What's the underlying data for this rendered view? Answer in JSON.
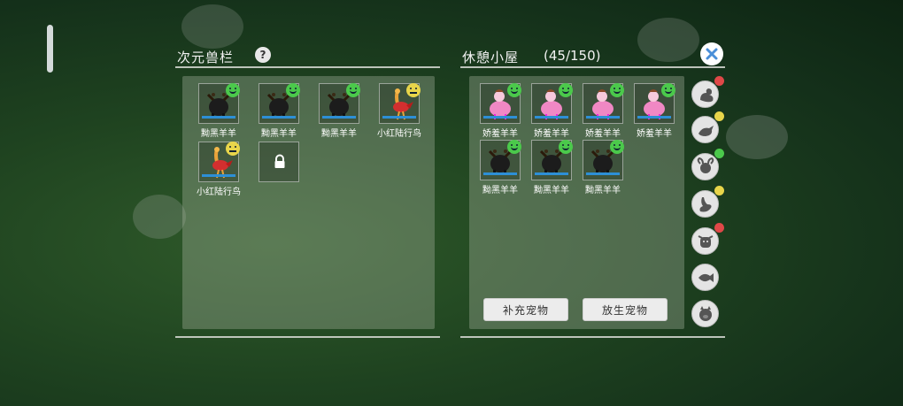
{
  "left_panel": {
    "title": "次元兽栏",
    "help_label": "?",
    "slots": [
      {
        "name": "黝黑羊羊",
        "animal": "black-sheep",
        "mood": "happy"
      },
      {
        "name": "黝黑羊羊",
        "animal": "black-sheep",
        "mood": "happy"
      },
      {
        "name": "黝黑羊羊",
        "animal": "black-sheep",
        "mood": "happy"
      },
      {
        "name": "小红陆行鸟",
        "animal": "red-bird",
        "mood": "meh"
      },
      {
        "name": "小红陆行鸟",
        "animal": "red-bird",
        "mood": "meh"
      }
    ],
    "locked_slot_icon": "lock-icon"
  },
  "right_panel": {
    "title": "休憩小屋",
    "count": "(45/150)",
    "slots": [
      {
        "name": "娇羞羊羊",
        "animal": "pink-sheep",
        "mood": "happy"
      },
      {
        "name": "娇羞羊羊",
        "animal": "pink-sheep",
        "mood": "happy"
      },
      {
        "name": "娇羞羊羊",
        "animal": "pink-sheep",
        "mood": "happy"
      },
      {
        "name": "娇羞羊羊",
        "animal": "pink-sheep",
        "mood": "happy"
      },
      {
        "name": "黝黑羊羊",
        "animal": "black-sheep",
        "mood": "happy"
      },
      {
        "name": "黝黑羊羊",
        "animal": "black-sheep",
        "mood": "happy"
      },
      {
        "name": "黝黑羊羊",
        "animal": "black-sheep",
        "mood": "happy"
      }
    ],
    "buttons": {
      "replenish": "补充宠物",
      "release": "放生宠物"
    }
  },
  "category_filters": [
    {
      "icon": "duck-icon",
      "status": "sad"
    },
    {
      "icon": "bird-icon",
      "status": "meh"
    },
    {
      "icon": "ram-icon",
      "status": "happy"
    },
    {
      "icon": "ostrich-icon",
      "status": "meh"
    },
    {
      "icon": "cow-icon",
      "status": "sad"
    },
    {
      "icon": "fish-icon",
      "status": ""
    },
    {
      "icon": "pig-icon",
      "status": ""
    }
  ],
  "colors": {
    "happy": "#4bc94b",
    "meh": "#e8d54a",
    "sad": "#e04848",
    "bar": "#2d8fd6"
  }
}
